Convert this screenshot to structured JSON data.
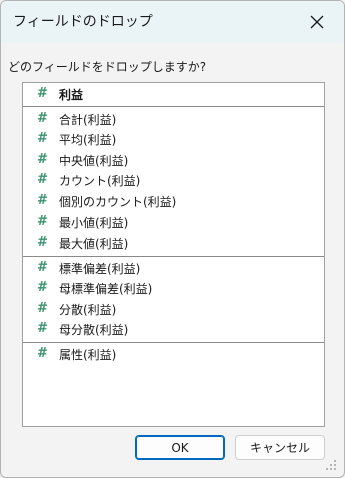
{
  "dialog": {
    "title": "フィールドのドロップ",
    "prompt": "どのフィールドをドロップしますか?",
    "ok_label": "OK",
    "cancel_label": "キャンセル"
  },
  "fields": {
    "icon_glyph": "#",
    "items": [
      {
        "label": "利益"
      },
      {
        "label": "合計(利益)"
      },
      {
        "label": "平均(利益)"
      },
      {
        "label": "中央値(利益)"
      },
      {
        "label": "カウント(利益)"
      },
      {
        "label": "個別のカウント(利益)"
      },
      {
        "label": "最小値(利益)"
      },
      {
        "label": "最大値(利益)"
      },
      {
        "label": "標準偏差(利益)"
      },
      {
        "label": "母標準偏差(利益)"
      },
      {
        "label": "分散(利益)"
      },
      {
        "label": "母分散(利益)"
      },
      {
        "label": "属性(利益)"
      }
    ]
  },
  "colors": {
    "titlebar": "#eaf4f6",
    "field_icon": "#3d9470",
    "ok_border": "#0067c0"
  }
}
